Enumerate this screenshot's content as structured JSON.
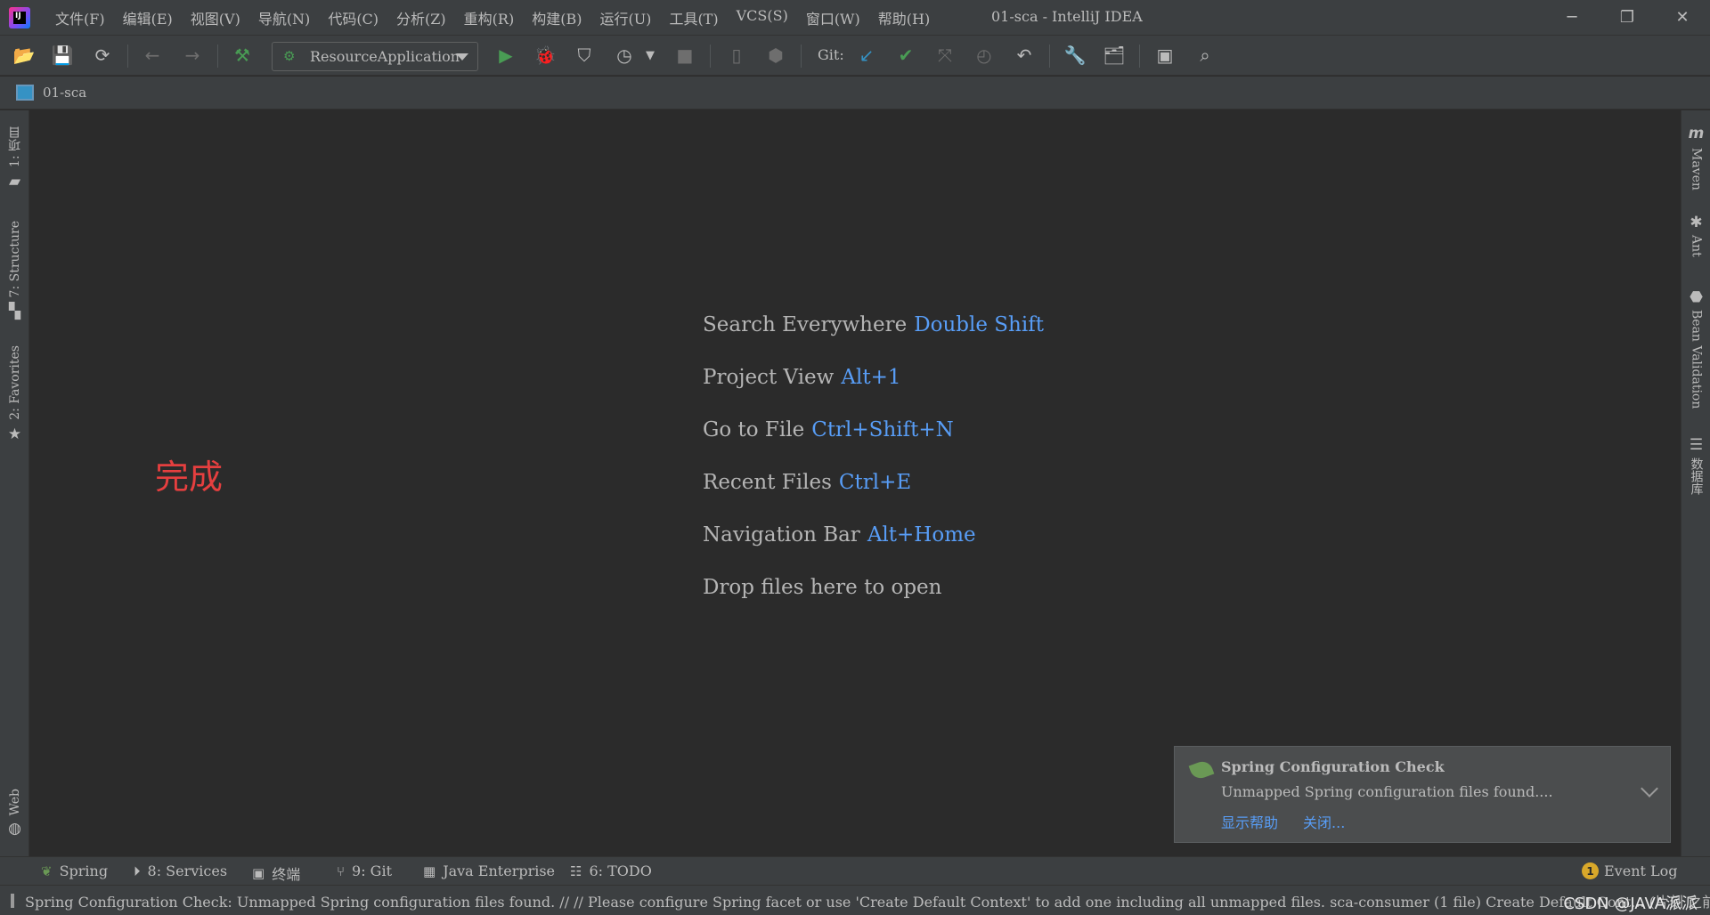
{
  "menu": [
    "文件(F)",
    "编辑(E)",
    "视图(V)",
    "导航(N)",
    "代码(C)",
    "分析(Z)",
    "重构(R)",
    "构建(B)",
    "运行(U)",
    "工具(T)",
    "VCS(S)",
    "窗口(W)",
    "帮助(H)"
  ],
  "window": {
    "title": "01-sca - IntelliJ IDEA"
  },
  "toolbar": {
    "run_config": "ResourceApplication",
    "git_label": "Git:",
    "colors": {
      "run": "#499c54",
      "git_update": "#3592c4",
      "git_commit": "#499c54"
    }
  },
  "navbar": {
    "project": "01-sca"
  },
  "left_tabs": [
    "1: 项目",
    "7: Structure",
    "2: Favorites",
    "Web"
  ],
  "right_tabs": [
    "Maven",
    "Ant",
    "Bean Validation",
    "数据库"
  ],
  "editor": {
    "hints": [
      {
        "label": "Search Everywhere",
        "key": "Double Shift"
      },
      {
        "label": "Project View",
        "key": "Alt+1"
      },
      {
        "label": "Go to File",
        "key": "Ctrl+Shift+N"
      },
      {
        "label": "Recent Files",
        "key": "Ctrl+E"
      },
      {
        "label": "Navigation Bar",
        "key": "Alt+Home"
      },
      {
        "label": "Drop files here to open",
        "key": ""
      }
    ],
    "overlay_text": "完成"
  },
  "notification": {
    "title": "Spring Configuration Check",
    "body": "Unmapped Spring configuration files found....",
    "actions": [
      "显示帮助",
      "关闭..."
    ]
  },
  "bottom_tabs": [
    "Spring",
    "8: Services",
    "终端",
    "9: Git",
    "Java Enterprise",
    "6: TODO"
  ],
  "event_log": {
    "label": "Event Log",
    "count": "1"
  },
  "status": {
    "message": "Spring Configuration Check: Unmapped Spring configuration files found. // // Please configure Spring facet or use 'Create Default Context' to add one including all unmapped files. sca-consumer (1 file)   Create Default Cont... (片刻 之前)"
  },
  "watermark": "CSDN @JAVA派派"
}
